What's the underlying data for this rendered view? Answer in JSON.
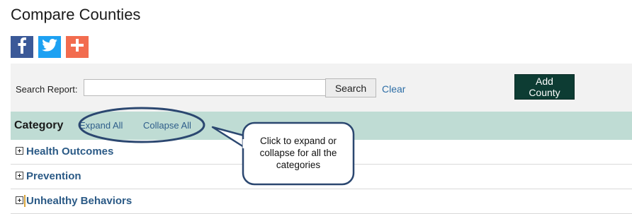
{
  "page": {
    "title": "Compare Counties"
  },
  "social": [
    {
      "name": "facebook-icon",
      "glyph": "f"
    },
    {
      "name": "twitter-icon",
      "glyph": "twitter"
    },
    {
      "name": "share-plus-icon",
      "glyph": "+"
    }
  ],
  "search": {
    "label": "Search Report:",
    "value": "",
    "placeholder": "",
    "button_label": "Search",
    "clear_label": "Clear"
  },
  "add_county_label": "Add County",
  "category_header": {
    "title": "Category",
    "expand_all": "Expand All",
    "collapse_all": "Collapse All"
  },
  "categories": [
    {
      "label": "Health Outcomes"
    },
    {
      "label": "Prevention"
    },
    {
      "label": "Unhealthy Behaviors"
    }
  ],
  "callout": {
    "text": "Click to expand or collapse for all the categories"
  },
  "colors": {
    "facebook": "#3b5998",
    "twitter": "#1da1f2",
    "share": "#f26c4f",
    "add_county_bg": "#0d3c33",
    "category_header_bg": "#bfdcd4",
    "link": "#2e6ea6",
    "callout_stroke": "#2b4770"
  }
}
